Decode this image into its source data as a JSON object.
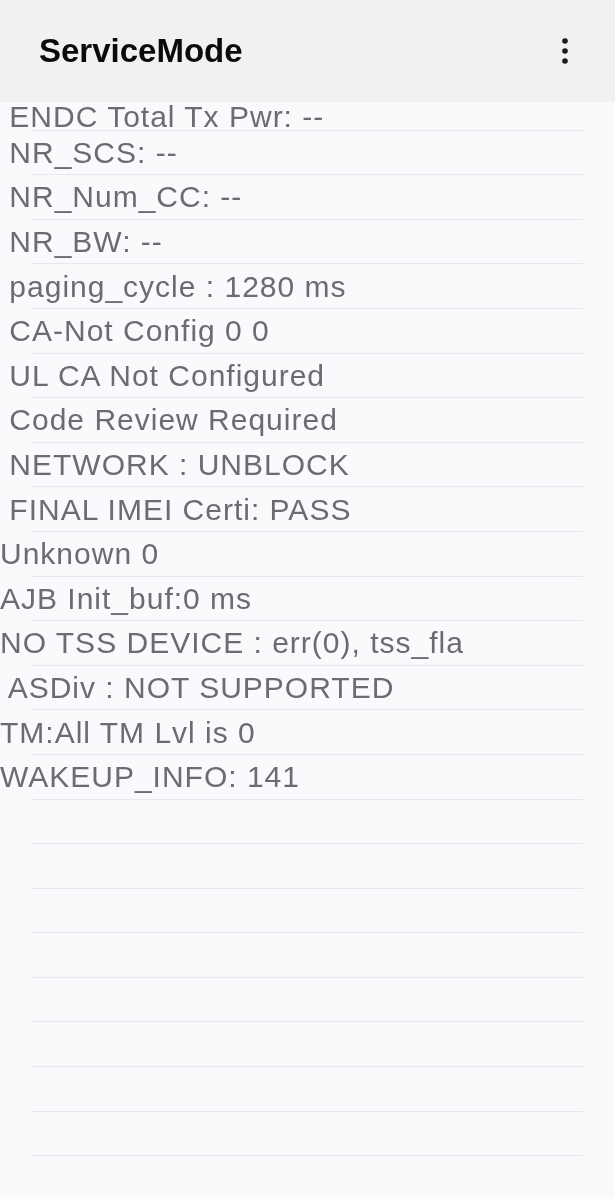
{
  "app_bar": {
    "title": "ServiceMode"
  },
  "lines": [
    " ENDC Total Tx Pwr: --",
    " NR_SCS: --",
    " NR_Num_CC: --",
    " NR_BW: --",
    " paging_cycle : 1280 ms",
    " CA-Not Config 0 0",
    " UL CA Not Configured",
    " Code Review Required",
    " NETWORK : UNBLOCK",
    " FINAL IMEI Certi: PASS",
    "Unknown 0",
    "AJB Init_buf:0 ms",
    "NO TSS DEVICE : err(0), tss_fla",
    " ASDiv : NOT SUPPORTED",
    "TM:All TM Lvl is 0",
    "WAKEUP_INFO: 141"
  ]
}
